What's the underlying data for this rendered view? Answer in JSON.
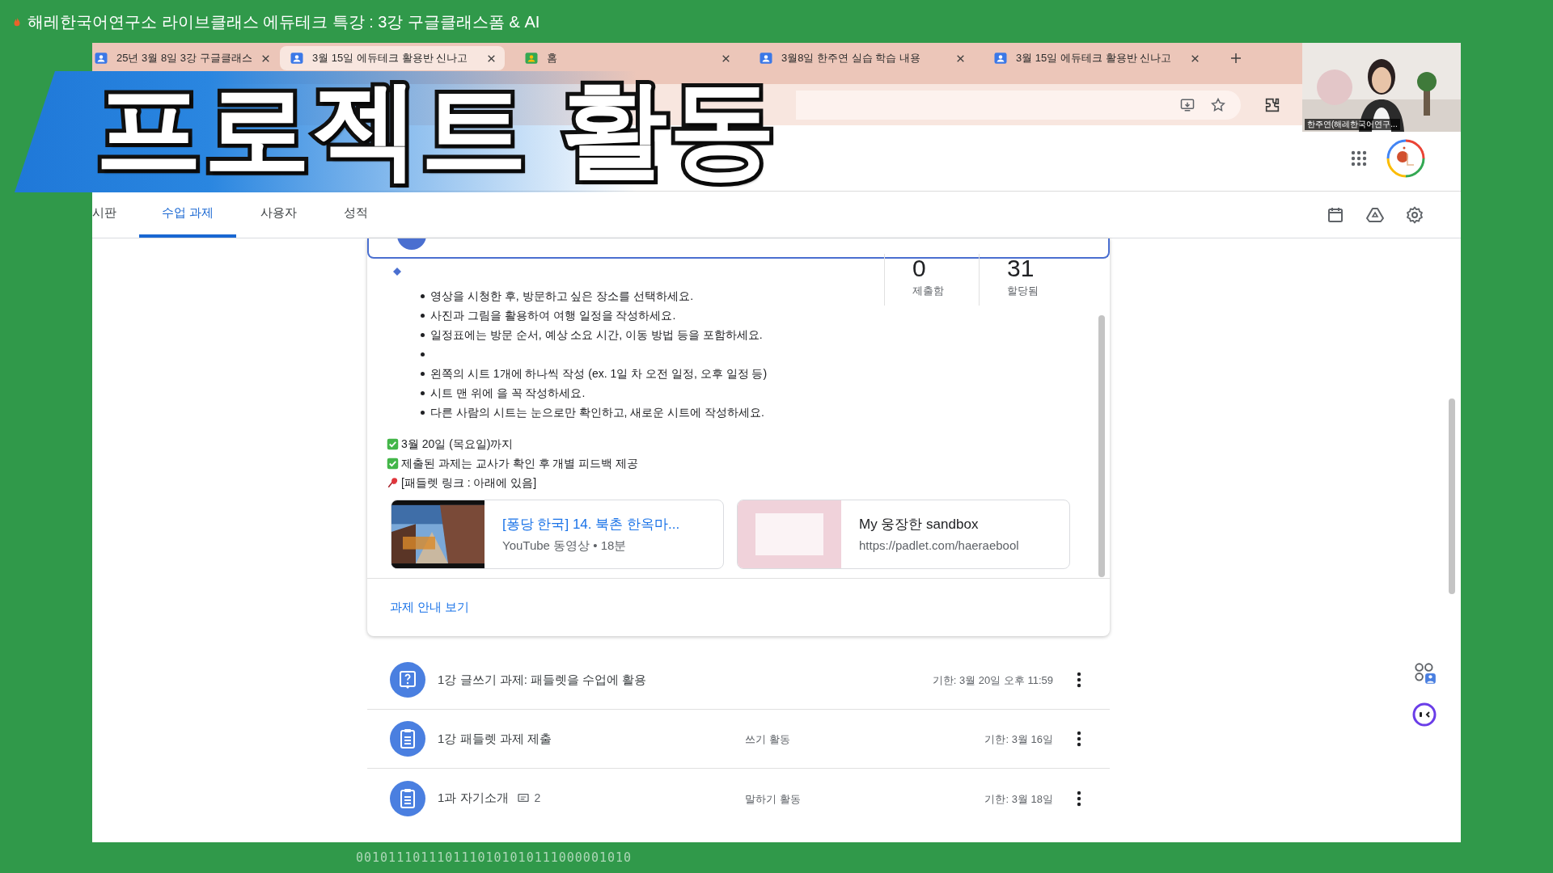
{
  "window": {
    "title": "해레한국어연구소 라이브클래스 에듀테크 특강 : 3강 구글클래스폼 & AI"
  },
  "headline": "프로젝트 활동",
  "webcam": {
    "caption": "한주연(해레한국어연구..."
  },
  "browser": {
    "tabs": [
      {
        "label": "25년 3월 8일 3강 구글클래스",
        "kind": "classroom",
        "selected": false
      },
      {
        "label": "3월 15일 에듀테크 활용반 신나고",
        "kind": "classroom",
        "selected": true
      },
      {
        "label": "홈",
        "kind": "home",
        "selected": false
      },
      {
        "label": "3월8일 한주연 실습 학습 내용",
        "kind": "classroom",
        "selected": false
      },
      {
        "label": "3월 15일 에듀테크 활용반 신나고",
        "kind": "classroom",
        "selected": false
      }
    ]
  },
  "classroom": {
    "nav_tabs": [
      {
        "label": "시판",
        "selected": false
      },
      {
        "label": "수업 과제",
        "selected": true
      },
      {
        "label": "사용자",
        "selected": false
      },
      {
        "label": "성적",
        "selected": false
      }
    ],
    "assignment": {
      "stats": [
        {
          "value": "0",
          "label": "제출함"
        },
        {
          "value": "31",
          "label": "할당됨"
        }
      ],
      "bullets": [
        {
          "kind": "text",
          "text": "영상을 시청한 후, 방문하고 싶은 장소를 선택하세요."
        },
        {
          "kind": "text",
          "text": "사진과 그림을 활용하여 여행 일정을 작성하세요."
        },
        {
          "kind": "text",
          "text": "일정표에는 방문 순서, 예상 소요 시간, 이동 방법 등을 포함하세요."
        },
        {
          "kind": "blank"
        },
        {
          "kind": "text",
          "text": "왼쪽의 시트 1개에 하나씩 작성 (ex. 1일 차 오전 일정, 오후 일정 등)"
        },
        {
          "kind": "text",
          "text": "시트 맨 위에 을 꼭 작성하세요."
        },
        {
          "kind": "text",
          "text": "다른 사람의 시트는 눈으로만 확인하고, 새로운 시트에 작성하세요."
        }
      ],
      "notes": [
        {
          "kind": "check",
          "text": "3월 20일 (목요일)까지"
        },
        {
          "kind": "check",
          "text": "제출된 과제는 교사가 확인 후 개별 피드백 제공"
        },
        {
          "kind": "pin",
          "text": "[패들렛 링크 : 아래에 있음]"
        }
      ],
      "attachments": [
        {
          "kind": "video",
          "title": "[퐁당 한국] 14. 북촌 한옥마...",
          "subtitle": "YouTube 동영상 • 18분"
        },
        {
          "kind": "link",
          "title": "My 웅장한 sandbox",
          "subtitle": "https://padlet.com/haeraebool"
        }
      ],
      "view_link": "과제 안내 보기"
    },
    "items": [
      {
        "kind": "question",
        "title": "1강 글쓰기 과제: 패들렛을 수업에 활용",
        "due": "기한: 3월 20일 오후 11:59"
      },
      {
        "kind": "assignment",
        "title": "1강 패들렛 과제 제출",
        "topic": "쓰기 활동",
        "due": "기한: 3월 16일"
      },
      {
        "kind": "assignment",
        "title": "1과 자기소개",
        "comments": "2",
        "topic": "말하기 활동",
        "due": "기한: 3월 18일"
      }
    ]
  },
  "background_digits": "0010111011101110101010111000001010"
}
